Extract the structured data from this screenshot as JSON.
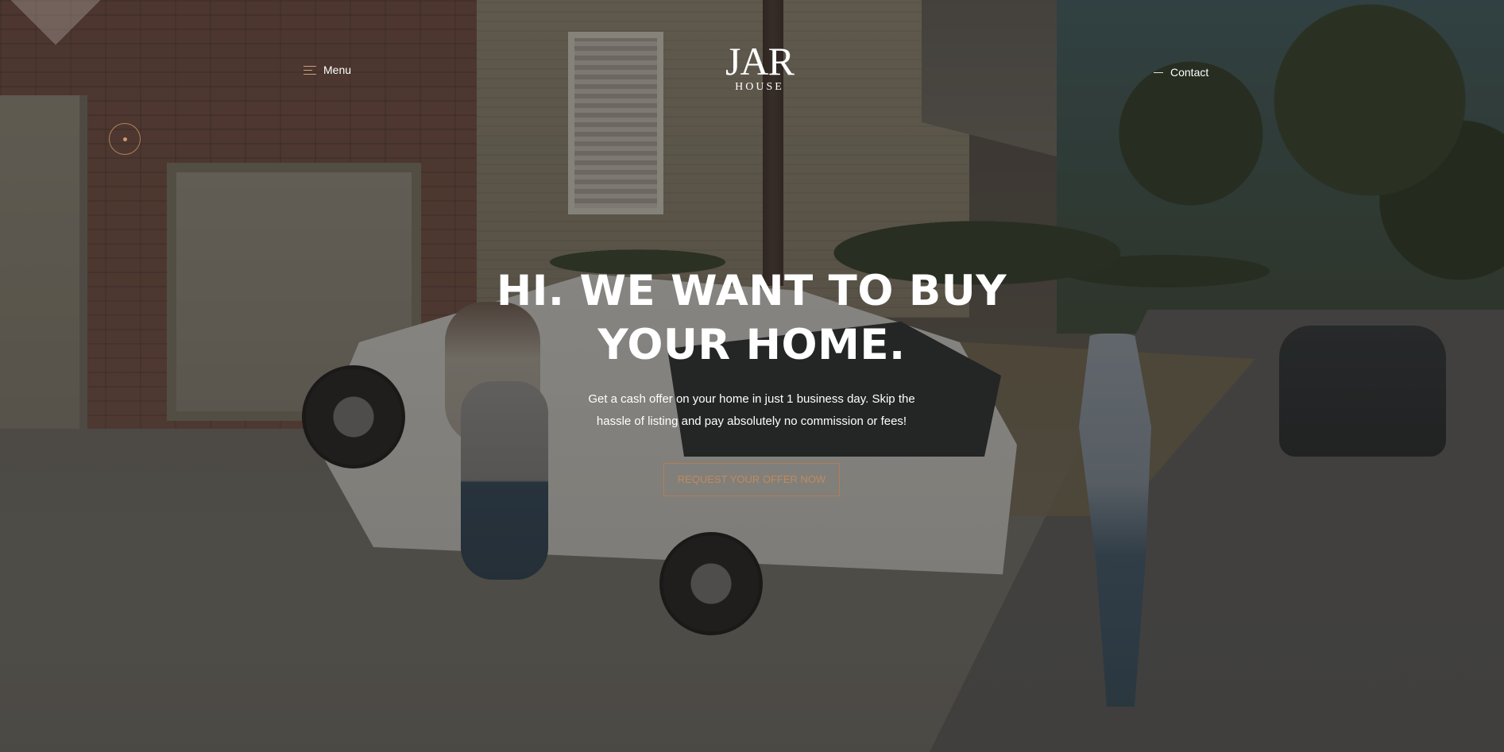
{
  "header": {
    "menu_label": "Menu",
    "contact_label": "Contact",
    "menu_icon": "hamburger-icon",
    "contact_icon": "dash-icon"
  },
  "logo": {
    "main": "JAR",
    "sub": "HOUSE"
  },
  "hero": {
    "title_line1": "HI. WE WANT TO BUY",
    "title_line2": "YOUR HOME.",
    "subtitle": "Get a cash offer on your home in just 1 business day. Skip the hassle of listing and pay absolutely no commission or fees!",
    "cta_label": "REQUEST YOUR OFFER NOW"
  },
  "colors": {
    "accent": "#c08a5c",
    "text": "#ffffff",
    "overlay": "#191816"
  },
  "sound_toggle": {
    "icon": "dot-icon"
  }
}
